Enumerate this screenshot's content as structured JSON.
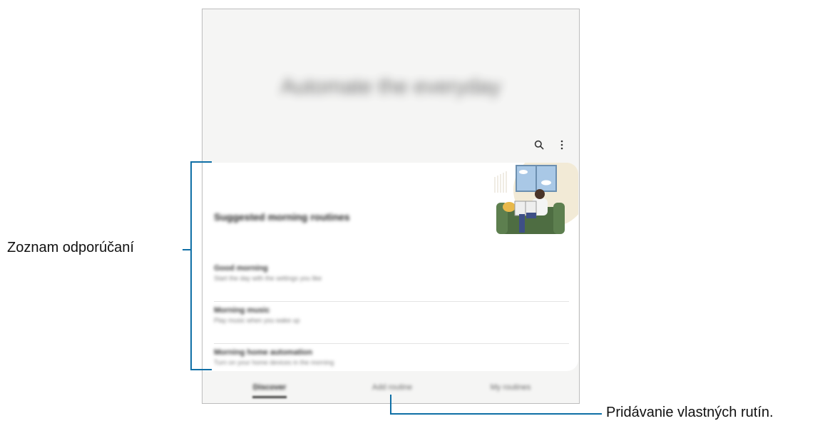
{
  "screen": {
    "hero_title": "Automate the everyday",
    "section_title": "Suggested morning routines",
    "list_items": [
      {
        "title": "Good morning",
        "subtitle": "Start the day with the settings you like"
      },
      {
        "title": "Morning music",
        "subtitle": "Play music when you wake up"
      },
      {
        "title": "Morning home automation",
        "subtitle": "Turn on your home devices in the morning"
      }
    ],
    "tabs": [
      {
        "label": "Discover"
      },
      {
        "label": "Add routine"
      },
      {
        "label": "My routines"
      }
    ],
    "icons": {
      "search": "search-icon",
      "more": "more-options-icon"
    }
  },
  "callouts": {
    "recommendations_label": "Zoznam odporúčaní",
    "add_custom_label": "Pridávanie vlastných rutín.",
    "line_color": "#0f6fa6"
  }
}
